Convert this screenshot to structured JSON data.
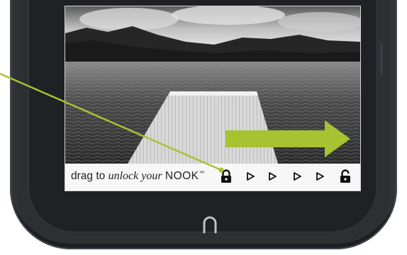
{
  "unlock_bar": {
    "prefix": "drag to",
    "italic": "unlock your",
    "brand": "NOOK",
    "trademark": "™"
  },
  "icons": {
    "lock": "lock-closed-icon",
    "arrows": [
      "play-arrow-icon",
      "play-arrow-icon",
      "play-arrow-icon",
      "play-arrow-icon",
      "play-arrow-icon"
    ],
    "unlocked": "lock-open-icon",
    "home": "nook-home-icon"
  },
  "colors": {
    "device_body": "#2d2f33",
    "callout_accent": "#a8c232",
    "screen_bg": "#f7f7f7"
  }
}
